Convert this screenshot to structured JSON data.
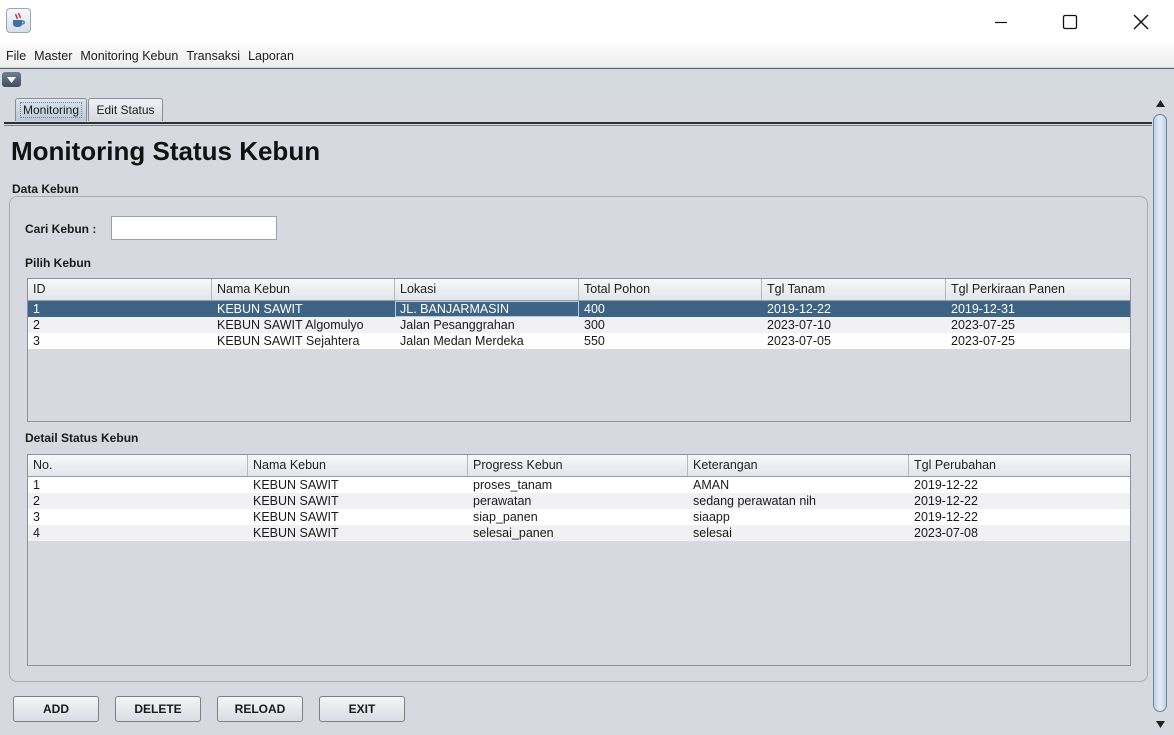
{
  "window": {
    "icon": "java-cup-icon",
    "controls": [
      "minimize-icon",
      "maximize-icon",
      "close-icon"
    ]
  },
  "menu": [
    "File",
    "Master",
    "Monitoring Kebun",
    "Transaksi",
    "Laporan"
  ],
  "tabs": [
    "Monitoring",
    "Edit Status"
  ],
  "page": {
    "title": "Monitoring Status Kebun",
    "section": "Data Kebun",
    "search_label": "Cari Kebun :",
    "search_value": "",
    "pilih_label": "Pilih Kebun",
    "detail_label": "Detail Status Kebun"
  },
  "kebun_table": {
    "columns": [
      "ID",
      "Nama Kebun",
      "Lokasi",
      "Total Pohon",
      "Tgl Tanam",
      "Tgl Perkiraan Panen"
    ],
    "rows": [
      [
        "1",
        "KEBUN SAWIT",
        "JL. BANJARMASIN",
        "400",
        "2019-12-22",
        "2019-12-31"
      ],
      [
        "2",
        "KEBUN SAWIT Algomulyo",
        "Jalan Pesanggrahan",
        "300",
        "2023-07-10",
        "2023-07-25"
      ],
      [
        "3",
        "KEBUN SAWIT Sejahtera",
        "Jalan Medan Merdeka",
        "550",
        "2023-07-05",
        "2023-07-25"
      ]
    ],
    "selected_row": 0
  },
  "detail_table": {
    "columns": [
      "No.",
      "Nama Kebun",
      "Progress Kebun",
      "Keterangan",
      "Tgl Perubahan"
    ],
    "rows": [
      [
        "1",
        "KEBUN SAWIT",
        "proses_tanam",
        "AMAN",
        "2019-12-22"
      ],
      [
        "2",
        "KEBUN SAWIT",
        "perawatan",
        "sedang perawatan nih",
        "2019-12-22"
      ],
      [
        "3",
        "KEBUN SAWIT",
        "siap_panen",
        "siaapp",
        "2019-12-22"
      ],
      [
        "4",
        "KEBUN SAWIT",
        "selesai_panen",
        "selesai",
        "2023-07-08"
      ]
    ]
  },
  "buttons": {
    "add": "ADD",
    "delete": "DELETE",
    "reload": "RELOAD",
    "exit": "EXIT"
  },
  "colors": {
    "selection": "#3d6385",
    "panel_bg": "#d6d9e0"
  }
}
